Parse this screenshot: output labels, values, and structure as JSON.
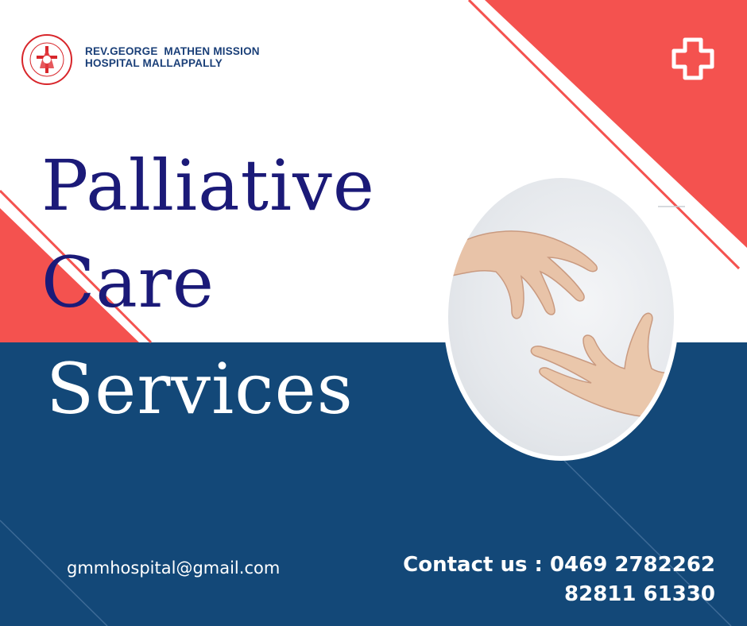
{
  "organization": {
    "name_line1": "REV.GEORGE  MATHEN MISSION",
    "name_line2": "HOSPITAL MALLAPPALLY",
    "logo_text": "REV GEORGE MATHEN MISSION HOSPITAL",
    "logo_subtext": "MALLAPPALLY"
  },
  "headline": {
    "line1": "Palliative",
    "line2": "Care",
    "line3": "Services"
  },
  "contact": {
    "email": "gmmhospital@gmail.com",
    "phone_line1": "Contact us : 0469 2782262",
    "phone_line2": "82811 61330"
  },
  "icons": {
    "medical_cross": "plus-icon",
    "logo": "hospital-logo"
  },
  "colors": {
    "coral": "#f4524f",
    "navy": "#134878",
    "headline_indigo": "#1b1a78",
    "white": "#ffffff"
  }
}
